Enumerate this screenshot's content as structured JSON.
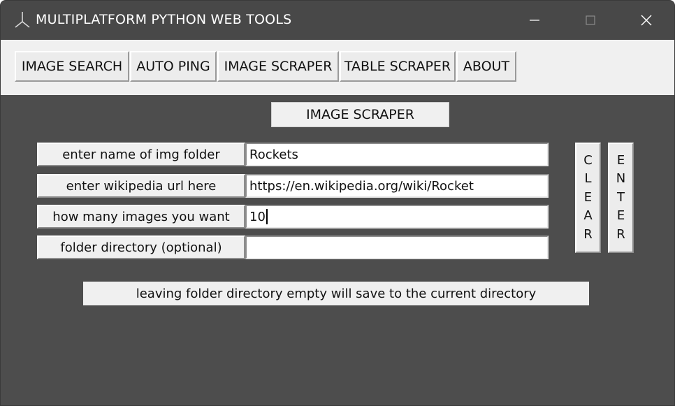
{
  "window": {
    "title": "MULTIPLATFORM PYTHON WEB TOOLS",
    "controls": {
      "minimize": "—",
      "maximize": "☐",
      "close": "✕"
    },
    "app_icon": "feather-icon"
  },
  "toolbar": {
    "tabs": [
      {
        "label": "IMAGE SEARCH"
      },
      {
        "label": "AUTO PING"
      },
      {
        "label": "IMAGE SCRAPER"
      },
      {
        "label": "TABLE SCRAPER"
      },
      {
        "label": "ABOUT"
      }
    ]
  },
  "main": {
    "heading": "IMAGE SCRAPER",
    "rows": [
      {
        "label": "enter name of img folder",
        "value": "Rockets"
      },
      {
        "label": "enter wikipedia url here",
        "value": "https://en.wikipedia.org/wiki/Rocket"
      },
      {
        "label": "how many images you want",
        "value": "10"
      },
      {
        "label": "folder directory (optional)",
        "value": ""
      }
    ],
    "clear_button": "CLEAR",
    "enter_button": "ENTER",
    "note": "leaving folder directory empty will save to the current directory"
  },
  "colors": {
    "background": "#4d4d4d",
    "titlebar": "#484848",
    "toolbar": "#f0f0f0",
    "widget": "#f0f0f0"
  }
}
